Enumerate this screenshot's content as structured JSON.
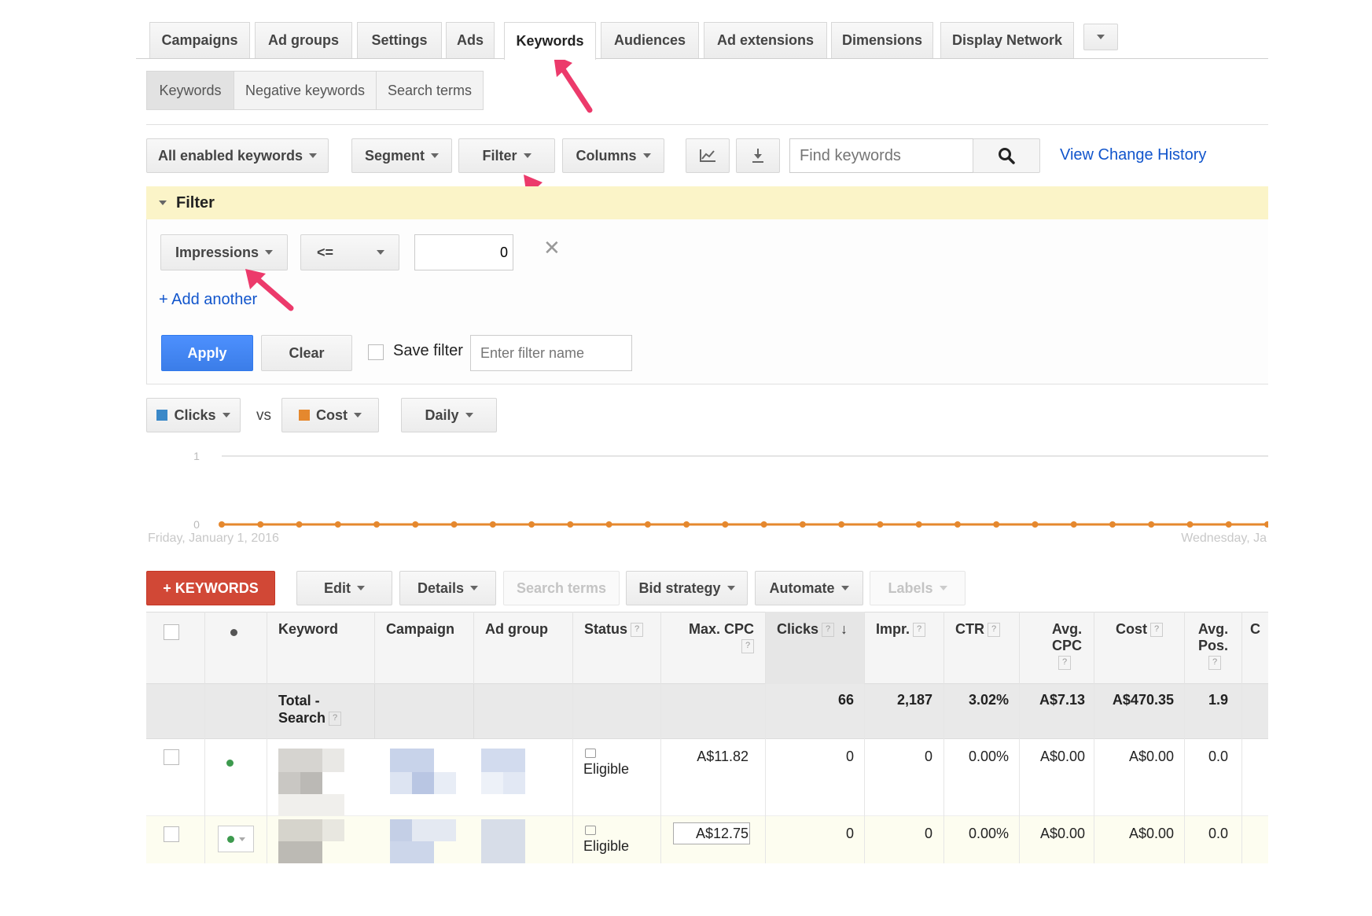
{
  "main_tabs": [
    "Campaigns",
    "Ad groups",
    "Settings",
    "Ads",
    "Keywords",
    "Audiences",
    "Ad extensions",
    "Dimensions",
    "Display Network"
  ],
  "sub_tabs": [
    "Keywords",
    "Negative keywords",
    "Search terms"
  ],
  "toolbar": {
    "status_filter": "All enabled keywords",
    "segment": "Segment",
    "filter": "Filter",
    "columns": "Columns",
    "search_placeholder": "Find keywords",
    "view_history": "View Change History"
  },
  "filter_panel": {
    "title": "Filter",
    "metric": "Impressions",
    "operator": "<=",
    "value": "0",
    "add_another": "+ Add another",
    "apply": "Apply",
    "clear": "Clear",
    "save_filter": "Save filter",
    "filter_name_placeholder": "Enter filter name"
  },
  "chart_controls": {
    "metric1": "Clicks",
    "vs": "vs",
    "metric2": "Cost",
    "period": "Daily",
    "metric1_color": "#3a88c8",
    "metric2_color": "#e5882e"
  },
  "chart_data": {
    "type": "line",
    "y_ticks": [
      "1",
      "0"
    ],
    "x_start_label": "Friday, January 1, 2016",
    "x_end_label": "Wednesday, Ja",
    "series": [
      {
        "name": "Cost",
        "color": "#e5882e",
        "values": [
          0,
          0,
          0,
          0,
          0,
          0,
          0,
          0,
          0,
          0,
          0,
          0,
          0,
          0,
          0,
          0,
          0,
          0,
          0,
          0,
          0,
          0,
          0,
          0,
          0,
          0,
          0,
          0
        ]
      }
    ]
  },
  "table_toolbar": {
    "add_keywords": "+ KEYWORDS",
    "edit": "Edit",
    "details": "Details",
    "search_terms": "Search terms",
    "bid_strategy": "Bid strategy",
    "automate": "Automate",
    "labels": "Labels"
  },
  "table": {
    "headers": {
      "keyword": "Keyword",
      "campaign": "Campaign",
      "ad_group": "Ad group",
      "status": "Status",
      "max_cpc": "Max. CPC",
      "clicks": "Clicks",
      "impr": "Impr.",
      "ctr": "CTR",
      "avg_cpc": "Avg. CPC",
      "cost": "Cost",
      "avg_pos": "Avg. Pos.",
      "next": "C"
    },
    "total": {
      "label": "Total - Search",
      "clicks": "66",
      "impr": "2,187",
      "ctr": "3.02%",
      "avg_cpc": "A$7.13",
      "cost": "A$470.35",
      "avg_pos": "1.9"
    },
    "rows": [
      {
        "status": "Eligible",
        "max_cpc": "A$11.82",
        "clicks": "0",
        "impr": "0",
        "ctr": "0.00%",
        "avg_cpc": "A$0.00",
        "cost": "A$0.00",
        "avg_pos": "0.0"
      },
      {
        "status": "Eligible",
        "max_cpc": "A$12.75",
        "clicks": "0",
        "impr": "0",
        "ctr": "0.00%",
        "avg_cpc": "A$0.00",
        "cost": "A$0.00",
        "avg_pos": "0.0"
      }
    ]
  }
}
